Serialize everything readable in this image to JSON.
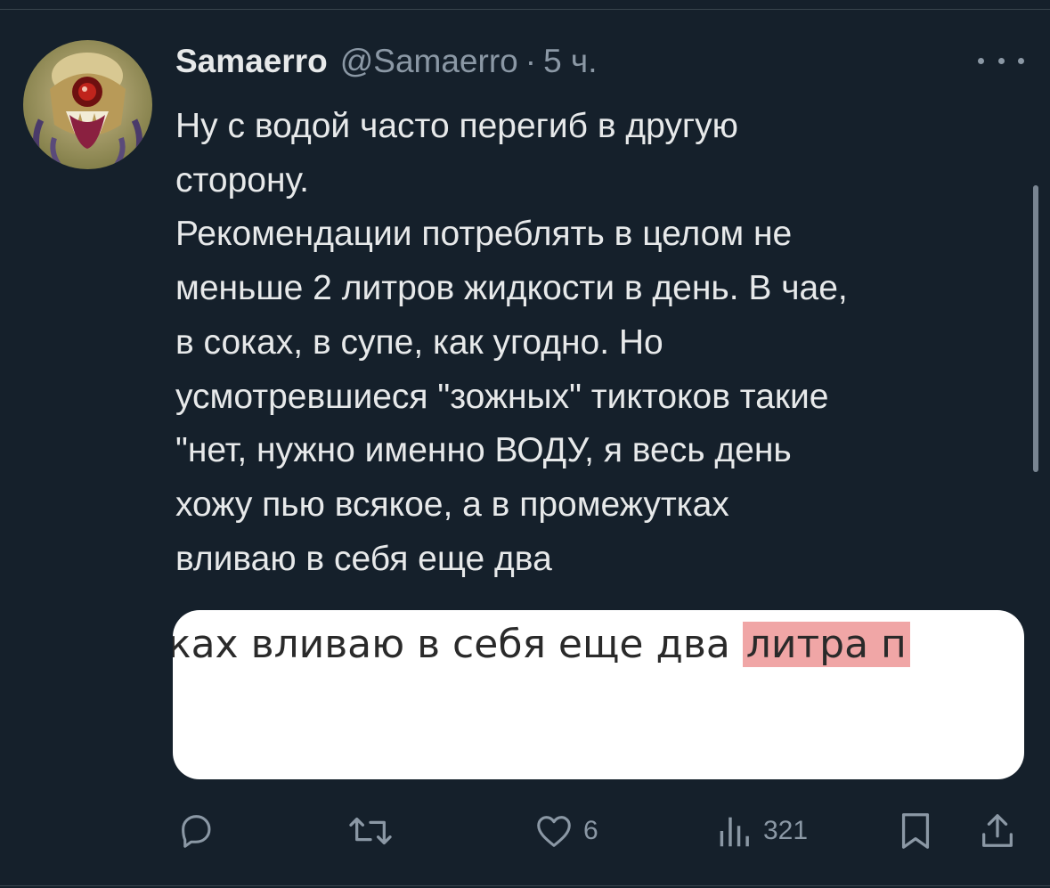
{
  "tweet": {
    "author_name": "Samaerro",
    "author_handle": "@Samaerro",
    "separator": "·",
    "time": "5 ч.",
    "text_lines": [
      "Ну с водой часто перегиб в другую",
      "сторону.",
      "Рекомендации потреблять в целом не",
      "меньше 2 литров жидкости в день. В чае,",
      "в соках, в супе, как угодно. Но",
      "усмотревшиеся \"зожных\" тиктоков такие",
      "\"нет, нужно именно ВОДУ, я весь день",
      "хожу пью всякое, а в промежутках",
      "вливаю в себя еще два"
    ]
  },
  "media": {
    "text_plain": "ках вливаю в себя еще два",
    "text_highlighted": "литра п",
    "highlight_color": "#f0a6a6"
  },
  "actions": {
    "reply_icon": "reply-icon",
    "retweet_icon": "retweet-icon",
    "like_icon": "heart-icon",
    "like_count": "6",
    "views_icon": "views-icon",
    "views_count": "321",
    "bookmark_icon": "bookmark-icon",
    "share_icon": "share-icon"
  },
  "colors": {
    "background": "#15202b",
    "text_primary": "#e7e9ea",
    "text_secondary": "#8b98a5"
  }
}
